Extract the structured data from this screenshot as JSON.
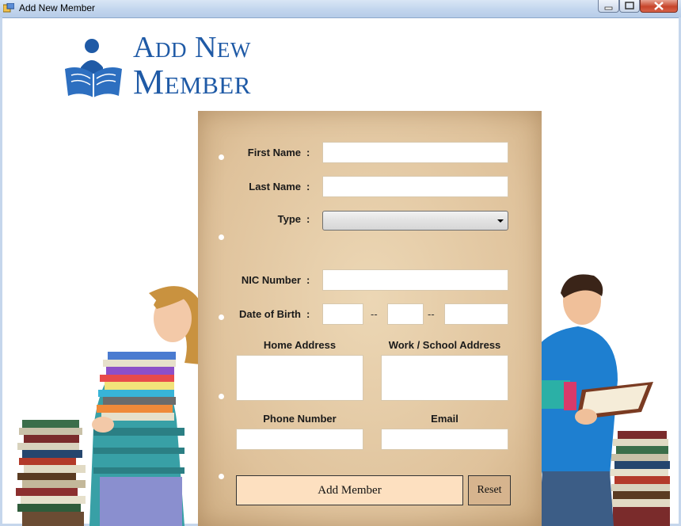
{
  "window": {
    "title": "Add New Member"
  },
  "logo": {
    "line1": "Add New",
    "line2": "Member"
  },
  "form": {
    "first_name_label": "First Name",
    "last_name_label": "Last Name",
    "type_label": "Type",
    "nic_label": "NIC Number",
    "dob_label": "Date of Birth",
    "colon": ":",
    "dob_separator": "--",
    "home_address_label": "Home Address",
    "work_address_label": "Work / School Address",
    "phone_label": "Phone Number",
    "email_label": "Email",
    "first_name_value": "",
    "last_name_value": "",
    "type_value": "",
    "nic_value": "",
    "dob_day": "",
    "dob_month": "",
    "dob_year": "",
    "home_address_value": "",
    "work_address_value": "",
    "phone_value": "",
    "email_value": ""
  },
  "buttons": {
    "add_member": "Add Member",
    "reset": "Reset"
  },
  "colors": {
    "title_blue": "#1f5aa6",
    "paper": "#e3c8a2",
    "add_button": "#fde0c0",
    "reset_button": "#d6b48e"
  }
}
